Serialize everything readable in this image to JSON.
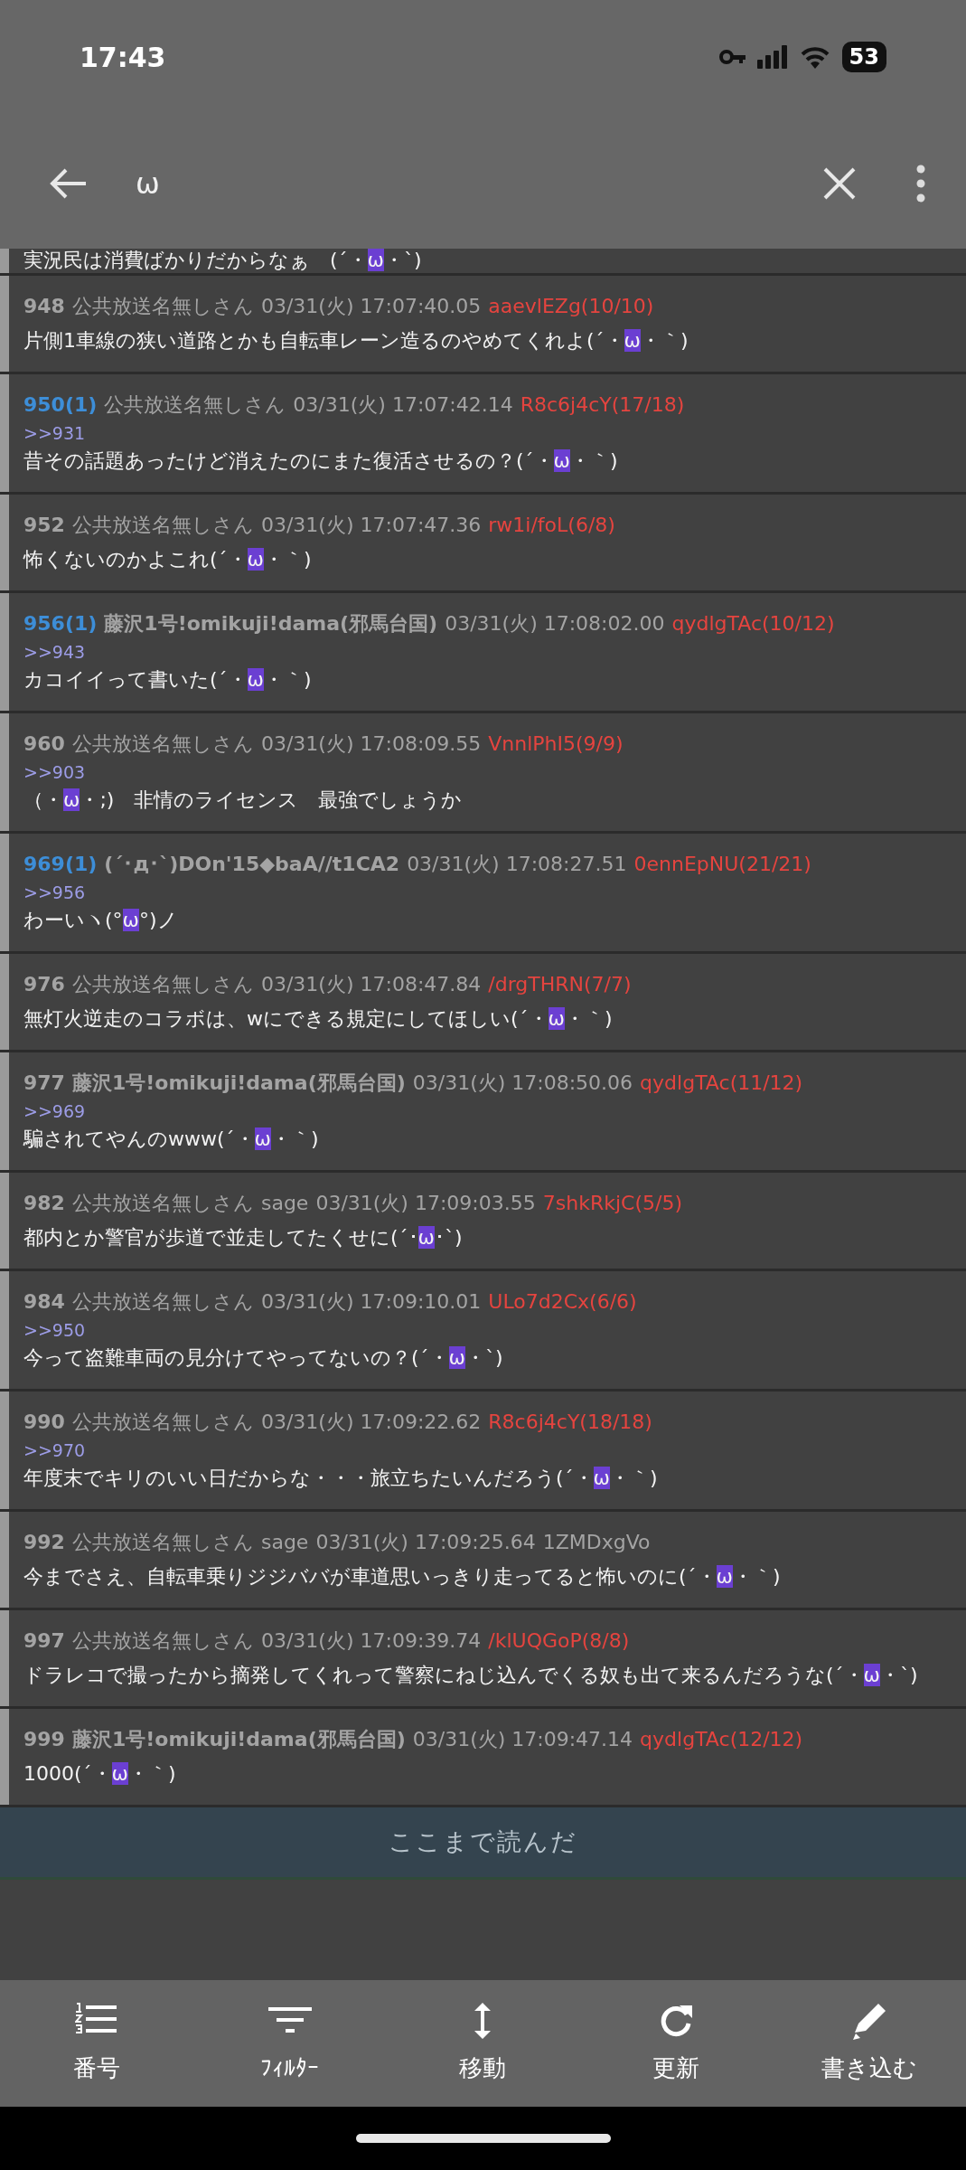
{
  "status_bar": {
    "time": "17:43",
    "battery": "53"
  },
  "toolbar": {
    "search": {
      "value": "ω"
    }
  },
  "partial_post": {
    "body": [
      {
        "text": "実況民は消費ばかりだからなぁ　(´・",
        "highlight": false
      },
      {
        "text": "ω",
        "highlight": true
      },
      {
        "text": "・`)",
        "highlight": false
      }
    ]
  },
  "posts": [
    {
      "number": "948",
      "name": "公共放送名無しさん",
      "named": false,
      "date": "03/31(火) 17:07:40.05",
      "id": "aaevlEZg(10/10)",
      "id_highlighted": true,
      "body": [
        {
          "text": "片側1車線の狭い道路とかも自転車レーン造るのやめてくれよ(´・",
          "highlight": false
        },
        {
          "text": "ω",
          "highlight": true
        },
        {
          "text": "・｀)",
          "highlight": false
        }
      ]
    },
    {
      "number": "950",
      "reply_count": "(1)",
      "name": "公共放送名無しさん",
      "named": false,
      "date": "03/31(火) 17:07:42.14",
      "id": "R8c6j4cY(17/18)",
      "id_highlighted": true,
      "reply_to": ">>931",
      "body": [
        {
          "text": "昔その話題あったけど消えたのにまた復活させるの？(´・",
          "highlight": false
        },
        {
          "text": "ω",
          "highlight": true
        },
        {
          "text": "・｀)",
          "highlight": false
        }
      ]
    },
    {
      "number": "952",
      "name": "公共放送名無しさん",
      "named": false,
      "date": "03/31(火) 17:07:47.36",
      "id": "rw1i/foL(6/8)",
      "id_highlighted": true,
      "body": [
        {
          "text": "怖くないのかよこれ(´・",
          "highlight": false
        },
        {
          "text": "ω",
          "highlight": true
        },
        {
          "text": "・｀)",
          "highlight": false
        }
      ]
    },
    {
      "number": "956",
      "reply_count": "(1)",
      "name": "藤沢1号!omikuji!dama(邪馬台国)",
      "named": true,
      "date": "03/31(火) 17:08:02.00",
      "id": "qydlgTAc(10/12)",
      "id_highlighted": true,
      "reply_to": ">>943",
      "body": [
        {
          "text": "カコイイって書いた(´・",
          "highlight": false
        },
        {
          "text": "ω",
          "highlight": true
        },
        {
          "text": "・｀)",
          "highlight": false
        }
      ]
    },
    {
      "number": "960",
      "name": "公共放送名無しさん",
      "named": false,
      "date": "03/31(火) 17:08:09.55",
      "id": "VnnlPhI5(9/9)",
      "id_highlighted": true,
      "reply_to": ">>903",
      "body": [
        {
          "text": "（・",
          "highlight": false
        },
        {
          "text": "ω",
          "highlight": true
        },
        {
          "text": "・;)　非情のライセンス　最強でしょうか",
          "highlight": false
        }
      ]
    },
    {
      "number": "969",
      "reply_count": "(1)",
      "name": "(´･д･`)DOn'15◆baA//t1CA2",
      "named": true,
      "date": "03/31(火) 17:08:27.51",
      "id": "0ennEpNU(21/21)",
      "id_highlighted": true,
      "reply_to": ">>956",
      "body": [
        {
          "text": "わーいヽ(°",
          "highlight": false
        },
        {
          "text": "ω",
          "highlight": true
        },
        {
          "text": "°)ノ",
          "highlight": false
        }
      ]
    },
    {
      "number": "976",
      "name": "公共放送名無しさん",
      "named": false,
      "date": "03/31(火) 17:08:47.84",
      "id": "/drgTHRN(7/7)",
      "id_highlighted": true,
      "body": [
        {
          "text": "無灯火逆走のコラボは、wにできる規定にしてほしい(´・",
          "highlight": false
        },
        {
          "text": "ω",
          "highlight": true
        },
        {
          "text": "・｀)",
          "highlight": false
        }
      ]
    },
    {
      "number": "977",
      "name": "藤沢1号!omikuji!dama(邪馬台国)",
      "named": true,
      "date": "03/31(火) 17:08:50.06",
      "id": "qydlgTAc(11/12)",
      "id_highlighted": true,
      "reply_to": ">>969",
      "body": [
        {
          "text": "騙されてやんのwww(´・",
          "highlight": false
        },
        {
          "text": "ω",
          "highlight": true
        },
        {
          "text": "・｀)",
          "highlight": false
        }
      ]
    },
    {
      "number": "982",
      "name": "公共放送名無しさん",
      "named": false,
      "mail": "sage",
      "date": "03/31(火) 17:09:03.55",
      "id": "7shkRkjC(5/5)",
      "id_highlighted": true,
      "body": [
        {
          "text": "都内とか警官が歩道で並走してたくせに(´･",
          "highlight": false
        },
        {
          "text": "ω",
          "highlight": true
        },
        {
          "text": "･`)",
          "highlight": false
        }
      ]
    },
    {
      "number": "984",
      "name": "公共放送名無しさん",
      "named": false,
      "date": "03/31(火) 17:09:10.01",
      "id": "ULo7d2Cx(6/6)",
      "id_highlighted": true,
      "reply_to": ">>950",
      "body": [
        {
          "text": "今って盗難車両の見分けてやってないの？(´・",
          "highlight": false
        },
        {
          "text": "ω",
          "highlight": true
        },
        {
          "text": "・`)",
          "highlight": false
        }
      ]
    },
    {
      "number": "990",
      "name": "公共放送名無しさん",
      "named": false,
      "date": "03/31(火) 17:09:22.62",
      "id": "R8c6j4cY(18/18)",
      "id_highlighted": true,
      "reply_to": ">>970",
      "body": [
        {
          "text": "年度末でキリのいい日だからな・・・旅立ちたいんだろう(´・",
          "highlight": false
        },
        {
          "text": "ω",
          "highlight": true
        },
        {
          "text": "・｀)",
          "highlight": false
        }
      ]
    },
    {
      "number": "992",
      "name": "公共放送名無しさん",
      "named": false,
      "mail": "sage",
      "date": "03/31(火) 17:09:25.64",
      "id": "1ZMDxgVo",
      "id_highlighted": false,
      "body": [
        {
          "text": "今までさえ、自転車乗りジジババが車道思いっきり走ってると怖いのに(´・",
          "highlight": false
        },
        {
          "text": "ω",
          "highlight": true
        },
        {
          "text": "・｀)",
          "highlight": false
        }
      ]
    },
    {
      "number": "997",
      "name": "公共放送名無しさん",
      "named": false,
      "date": "03/31(火) 17:09:39.74",
      "id": "/klUQGoP(8/8)",
      "id_highlighted": true,
      "body": [
        {
          "text": "ドラレコで撮ったから摘発してくれって警察にねじ込んでくる奴も出て来るんだろうな(´・",
          "highlight": false
        },
        {
          "text": "ω",
          "highlight": true
        },
        {
          "text": "・`)",
          "highlight": false
        }
      ]
    },
    {
      "number": "999",
      "name": "藤沢1号!omikuji!dama(邪馬台国)",
      "named": true,
      "date": "03/31(火) 17:09:47.14",
      "id": "qydlgTAc(12/12)",
      "id_highlighted": true,
      "body": [
        {
          "text": "1000(´・",
          "highlight": false
        },
        {
          "text": "ω",
          "highlight": true
        },
        {
          "text": "・｀)",
          "highlight": false
        }
      ]
    }
  ],
  "read_marker": "ここまで読んだ",
  "bottom_nav": [
    {
      "kind": "numbers",
      "label": "番号"
    },
    {
      "kind": "filter",
      "label": "ﾌｨﾙﾀｰ"
    },
    {
      "kind": "move",
      "label": "移動"
    },
    {
      "kind": "refresh",
      "label": "更新"
    },
    {
      "kind": "write",
      "label": "書き込む"
    }
  ]
}
